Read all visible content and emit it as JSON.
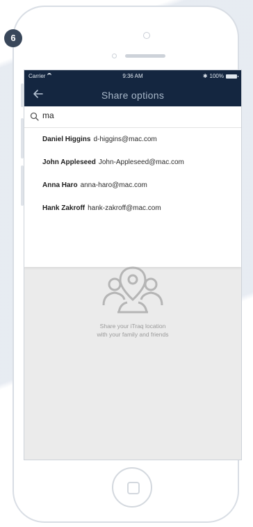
{
  "step_badge": "6",
  "status_bar": {
    "carrier": "Carrier",
    "time": "9:36 AM",
    "battery": "100%"
  },
  "nav": {
    "title": "Share options"
  },
  "search": {
    "value": "ma"
  },
  "results": [
    {
      "name": "Daniel Higgins",
      "email": "d-higgins@mac.com"
    },
    {
      "name": "John Appleseed",
      "email": "John-Appleseed@mac.com"
    },
    {
      "name": "Anna Haro",
      "email": "anna-haro@mac.com"
    },
    {
      "name": "Hank Zakroff",
      "email": "hank-zakroff@mac.com"
    }
  ],
  "empty_state": {
    "line1": "Share your iTraq location",
    "line2": "with your family and friends"
  },
  "colors": {
    "nav_bg": "#142640",
    "badge_bg": "#39475a",
    "screen_bg": "#ebebeb"
  }
}
